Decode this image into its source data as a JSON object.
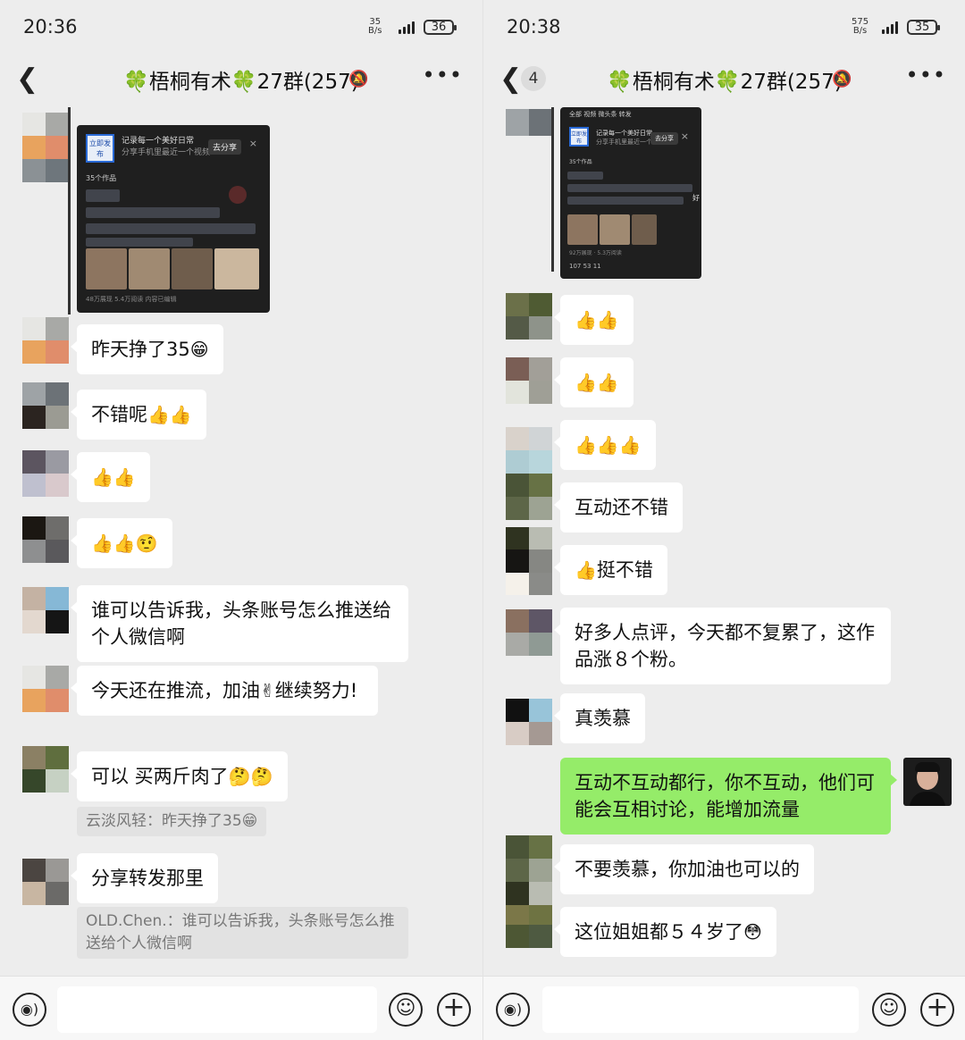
{
  "left": {
    "status": {
      "time": "20:36",
      "net_speed": "35",
      "net_unit": "B/s",
      "battery": "36"
    },
    "header": {
      "back_icon": "chevron-left",
      "title": "🍀梧桐有术🍀27群(257)",
      "mute_icon": "bell-off",
      "more_icon": "ellipsis"
    },
    "card": {
      "logo_text": "立即发布",
      "line1": "记录每一个美好日常",
      "line2": "分享手机里最近一个视频",
      "share": "去分享",
      "close": "×",
      "count": "35个作品",
      "footer": "48万展现  5.4万阅读  内容已编辑"
    },
    "messages": [
      {
        "text": "昨天挣了35",
        "emoji": "😁"
      },
      {
        "text": "不错呢",
        "emoji": "👍👍"
      },
      {
        "text": "",
        "emoji": "👍👍"
      },
      {
        "text": "",
        "emoji": "👍👍🤨"
      },
      {
        "text": "谁可以告诉我，头条账号怎么推送给个人微信啊",
        "emoji": ""
      },
      {
        "text_a": "今天还在推流，加油",
        "emoji": "✌",
        "text_b": "继续努力!"
      },
      {
        "text": "可以 买两斤肉了",
        "emoji": "🤔🤔",
        "quote": "云淡风轻：昨天挣了35😁"
      },
      {
        "text": "分享转发那里",
        "quote": "OLD.Chen.：谁可以告诉我，头条账号怎么推送给个人微信啊"
      }
    ],
    "input": {
      "voice_icon": "voice",
      "emoji_icon": "smiley",
      "plus_icon": "plus",
      "value": ""
    }
  },
  "right": {
    "status": {
      "time": "20:38",
      "net_speed": "575",
      "net_unit": "B/s",
      "battery": "35"
    },
    "header": {
      "back_icon": "chevron-left",
      "unread": "4",
      "title": "🍀梧桐有术🍀27群(257)",
      "mute_icon": "bell-off",
      "more_icon": "ellipsis"
    },
    "card": {
      "tabs": "全部   视频   微头条   转发",
      "logo_text": "立即发布",
      "line1": "记录每一个美好日常",
      "line2": "分享手机里最近一个视频",
      "share": "去分享",
      "close": "×",
      "count": "35个作品",
      "footer": "92万展现 · 5.3万阅读",
      "stats": "107   53   11",
      "side_char": "好"
    },
    "messages": [
      {
        "text": "",
        "emoji": "👍👍"
      },
      {
        "text": "",
        "emoji": "👍👍"
      },
      {
        "text": "",
        "emoji": "👍👍👍"
      },
      {
        "text": "互动还不错"
      },
      {
        "text": "挺不错",
        "emoji": "👍"
      },
      {
        "text": "好多人点评，今天都不复累了，这作品涨８个粉。"
      },
      {
        "text": "真羡慕"
      },
      {
        "text": "互动不互动都行，你不互动，他们可能会互相讨论，能增加流量",
        "mine": true
      },
      {
        "text": "不要羡慕，你加油也可以的"
      },
      {
        "text": "这位姐姐都５４岁了",
        "emoji": "😳"
      }
    ],
    "input": {
      "voice_icon": "voice",
      "emoji_icon": "smiley",
      "plus_icon": "plus",
      "value": ""
    }
  },
  "colors": {
    "background": "#ededed",
    "bubble": "#ffffff",
    "my_bubble": "#95ec69",
    "quote": "#e2e2e2"
  }
}
